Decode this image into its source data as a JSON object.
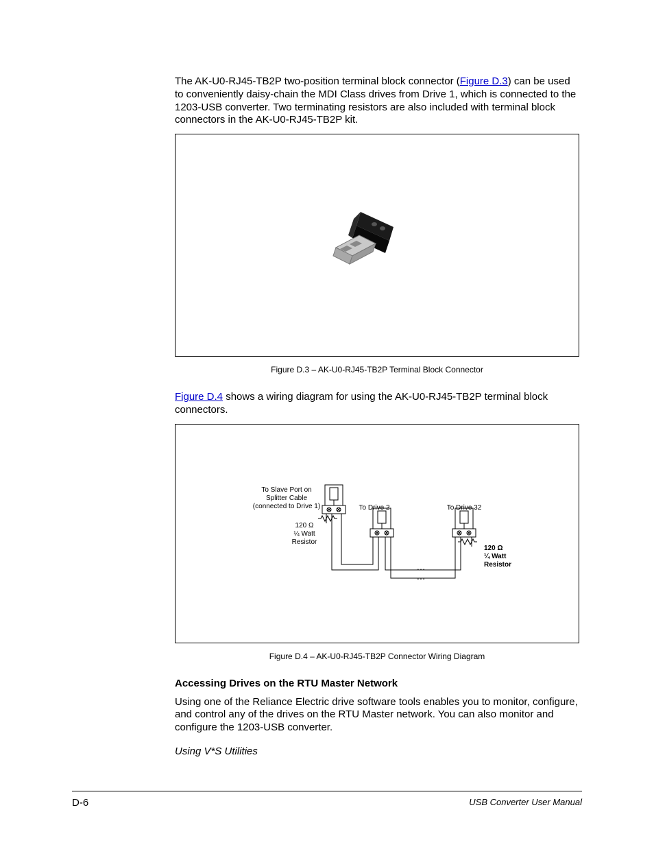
{
  "para1": {
    "pre": "The AK-U0-RJ45-TB2P two-position terminal block connector (",
    "link": "Figure D.3",
    "post": ") can be used to conveniently daisy-chain the MDI Class drives from Drive 1, which is connected to the 1203-USB converter. Two terminating resistors are also included with terminal block connectors in the AK-U0-RJ45-TB2P kit."
  },
  "fig3_caption": "Figure D.3 –  AK-U0-RJ45-TB2P Terminal Block Connector",
  "para2": {
    "link": "Figure D.4",
    "post": " shows a wiring diagram for using the AK-U0-RJ45-TB2P terminal block connectors."
  },
  "fig4_caption": "Figure D.4 –  AK-U0-RJ45-TB2P Connector Wiring Diagram",
  "heading1": "Accessing Drives on the RTU Master Network",
  "para3": "Using one of the Reliance Electric drive software tools enables you to monitor, configure, and control any of the drives on the RTU Master network. You can also monitor and configure the 1203-USB converter.",
  "heading2": "Using V*S Utilities",
  "footer": {
    "pageno": "D-6",
    "manual": "USB Converter User Manual"
  },
  "diagram": {
    "slave_port_l1": "To Slave Port on",
    "slave_port_l2": "Splitter Cable",
    "slave_port_l3": "(connected to Drive 1)",
    "to_drive2": "To Drive 2",
    "to_drive32": "To Drive 32",
    "resistor_l1": "120 Ω",
    "resistor_l2": "¼ Watt",
    "resistor_l3": "Resistor",
    "resistor2_l1": "120 Ω",
    "resistor2_l2": "¼ Watt",
    "resistor2_l3": "Resistor",
    "ellipsis": "…"
  }
}
